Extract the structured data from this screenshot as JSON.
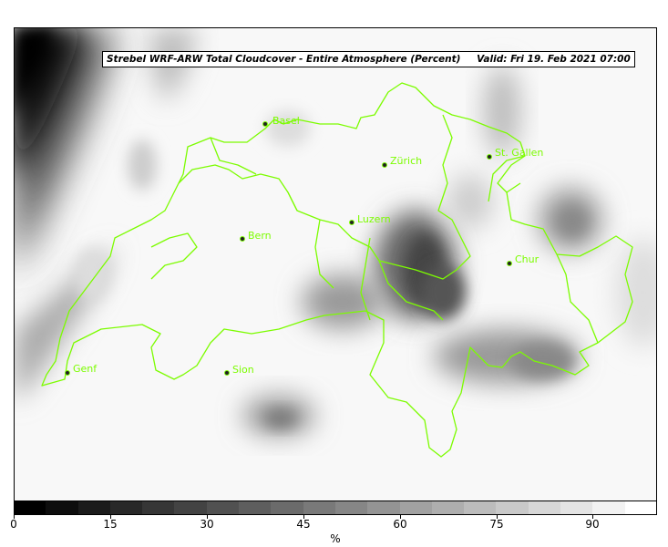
{
  "title": {
    "main": "Strebel WRF-ARW Total Cloudcover - Entire Atmosphere (Percent)",
    "valid": "Valid: Fri 19. Feb 2021 07:00"
  },
  "cities": [
    {
      "name": "Basel"
    },
    {
      "name": "Zürich"
    },
    {
      "name": "St. Gallen"
    },
    {
      "name": "Luzern"
    },
    {
      "name": "Bern"
    },
    {
      "name": "Chur"
    },
    {
      "name": "Genf"
    },
    {
      "name": "Sion"
    }
  ],
  "colorbar": {
    "unit": "%",
    "ticks": [
      "0",
      "15",
      "30",
      "45",
      "60",
      "75",
      "90"
    ],
    "range": [
      0,
      100
    ],
    "levels": 20
  },
  "colors": {
    "border": "#7cfc00",
    "background": "#f8f8f8"
  }
}
